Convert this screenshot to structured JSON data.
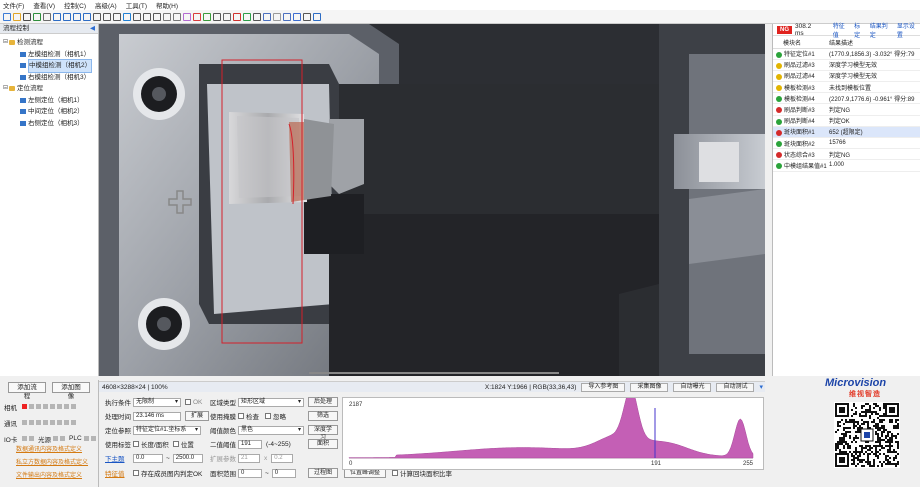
{
  "menu": [
    "文件(F)",
    "查看(V)",
    "控制(C)",
    "高级(A)",
    "工具(T)",
    "帮助(H)"
  ],
  "toolbar_icons": [
    "new-icon",
    "open-icon",
    "save-icon",
    "saveas-icon",
    "grid-icon",
    "zoom-in-icon",
    "zoom-out-icon",
    "zoom-fit-icon",
    "zoom-reset-icon",
    "pan-icon",
    "move-icon",
    "cursor-icon",
    "play-icon",
    "stop-icon",
    "record-icon",
    "crop-icon",
    "ruler-icon",
    "measure-icon",
    "color-icon",
    "target-icon",
    "cross-icon",
    "grid2-icon",
    "rect-icon",
    "location-icon",
    "check-icon",
    "print-icon",
    "camera-icon",
    "export-icon",
    "folder-icon",
    "screen-icon",
    "window-icon",
    "settings-icon"
  ],
  "process": {
    "title": "流程控制",
    "groups": [
      {
        "label": "检测流程",
        "items": [
          "左模组检测（相机1）",
          "中模组检测（相机2）",
          "右模组检测（相机3）"
        ]
      },
      {
        "label": "定位流程",
        "items": [
          "左侧定位（相机1）",
          "中间定位（相机2）",
          "右侧定位（相机3）"
        ]
      }
    ],
    "selected_item": "中模组检测（相机2）"
  },
  "bottom_left": {
    "add_process": "添加流程",
    "add_image": "添加图像",
    "devices": [
      {
        "label": "相机",
        "states": [
          "red",
          "off",
          "off",
          "off",
          "off",
          "off",
          "off",
          "off"
        ]
      },
      {
        "label": "通讯",
        "states": [
          "off",
          "off",
          "off",
          "off",
          "off",
          "off",
          "off",
          "off"
        ]
      },
      {
        "label": "IO卡",
        "states": [
          "off",
          "off"
        ],
        "extra1": "光源",
        "extra1_states": [
          "off",
          "off"
        ],
        "extra2": "PLC",
        "extra2_states": [
          "off",
          "off"
        ]
      }
    ],
    "links": [
      "数据通讯内容及格式定义",
      "私立方数据内容及格式定义",
      "文件输出内容及格式定义"
    ]
  },
  "viewer_status": {
    "image_info": "4608×3288×24 | 100%",
    "coord": "X:1824 Y:1966 | RGB(33,36,43)",
    "buttons": [
      "导入参考图",
      "采集图像",
      "自动曝光",
      "自动测试"
    ]
  },
  "params": {
    "exec_condition_label": "执行条件",
    "exec_condition_value": "无限制",
    "ok_check": "OK",
    "proc_time_label": "处理时间",
    "proc_time_value": "23.146 ms",
    "expand_btn": "扩展",
    "anchor_label": "定位参照",
    "anchor_value": "特征定位#1.坐标系",
    "use_label_label": "使用标签",
    "use_label_option1": "长度/面积",
    "use_label_option2": "位置",
    "lower_limit_label": "下主题",
    "range_min": "0.0",
    "range_max": "2500.0",
    "feature_label": "特征值",
    "feature_check": "存在成员图内判定OK",
    "region_type_label": "区域类型",
    "region_type_value": "矩形区域",
    "mask_label": "使用掩膜",
    "mask_opt1": "检查",
    "mask_opt2": "忽略",
    "color_label": "阈值颜色",
    "color_value": "黑色",
    "binarize_label": "二值阈值",
    "binarize_value": "191",
    "binarize_range": "(-4~255)",
    "expand_param_label": "扩展参数",
    "expand_a": "21",
    "expand_b": "0.2",
    "area_range_label": "面积范围",
    "area_min": "0",
    "area_max": "0",
    "postproc_btn": "后处理",
    "filter_btn": "筛选",
    "deep_learn_btn": "深度学习",
    "area_btn": "面积",
    "filter_view_btn": "过程图",
    "peak_btn": "位置峰调整",
    "peak_check": "计算回块面积比率"
  },
  "histogram": {
    "peak_value": "2187",
    "x_min": "0",
    "x_marker": "191",
    "x_max": "255"
  },
  "results": {
    "status": "NG",
    "time": "308.2 ms",
    "links": [
      "特征值",
      "标定",
      "结果判定",
      "显示设置"
    ],
    "headers": [
      "模块名",
      "结果描述"
    ],
    "rows": [
      {
        "status": "ok",
        "name": "特征定位#1",
        "desc": "(1770.9,1856.3) -3.032° 得分:79"
      },
      {
        "status": "warn",
        "name": "刷品过滤#3",
        "desc": "深度学习模型无效"
      },
      {
        "status": "warn",
        "name": "刷品过滤#4",
        "desc": "深度学习模型无效"
      },
      {
        "status": "warn",
        "name": "模板检测#3",
        "desc": "未找到模板位置"
      },
      {
        "status": "ok",
        "name": "模板检测#4",
        "desc": "(2207.9,1776.6) -0.961° 得分:89"
      },
      {
        "status": "ng",
        "name": "刷品判断#3",
        "desc": "判定NG"
      },
      {
        "status": "ok",
        "name": "刷品判断#4",
        "desc": "判定OK"
      },
      {
        "status": "ng",
        "name": "斑块面积#1",
        "desc": "652 (超限定)"
      },
      {
        "status": "ok",
        "name": "斑块面积#2",
        "desc": "15766"
      },
      {
        "status": "ng",
        "name": "状态综合#3",
        "desc": "判定NG"
      },
      {
        "status": "ok",
        "name": "中模组结果值#1",
        "desc": "1.000"
      }
    ],
    "selected_row": 7
  },
  "brand": {
    "name": "Microvision",
    "cn": "维视智造"
  },
  "colors": {
    "accent": "#1a56c4",
    "ng": "#e0231f",
    "ok": "#2ba33a",
    "warn": "#e2b400",
    "roi": "#d4202a",
    "histogram": "#c45fb5",
    "marker": "#4433cc"
  }
}
